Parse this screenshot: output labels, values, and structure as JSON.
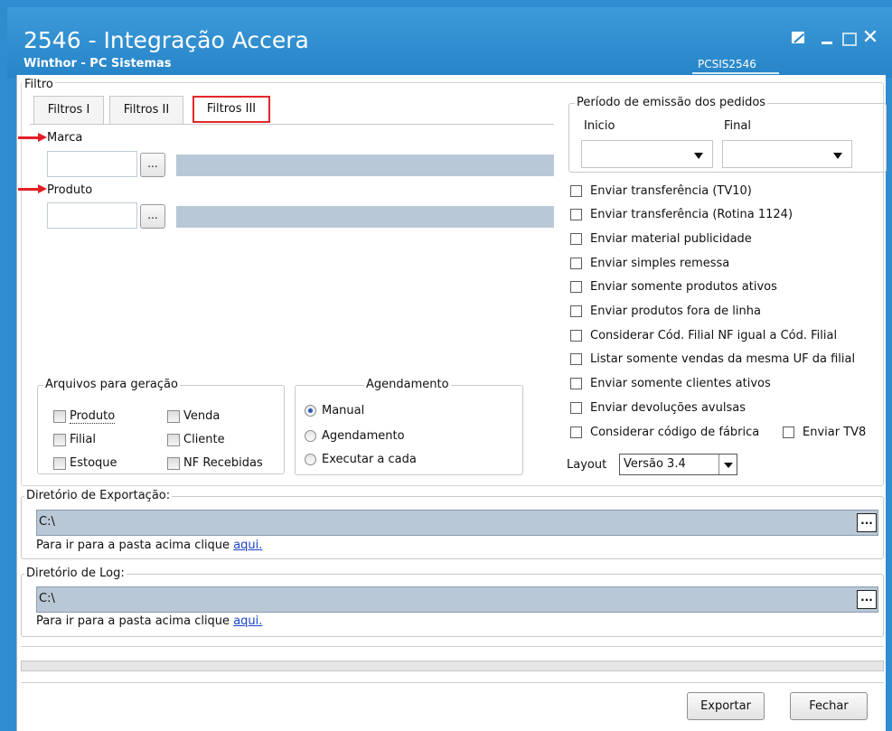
{
  "window": {
    "title": "2546 - Integração Accera",
    "subtitle": "Winthor - PC Sistemas",
    "code": "PCSIS2546",
    "close_glyph": "✕"
  },
  "filtro": {
    "legend": "Filtro",
    "tabs": [
      "Filtros I",
      "Filtros II",
      "Filtros III"
    ],
    "active_tab": "Filtros III",
    "marca_label": "Marca",
    "produto_label": "Produto",
    "ellipsis": "..."
  },
  "periodo": {
    "legend": "Período de emissão dos pedidos",
    "inicio_label": "Inicio",
    "final_label": "Final"
  },
  "options": [
    "Enviar transferência (TV10)",
    "Enviar transferência (Rotina 1124)",
    "Enviar material publicidade",
    "Enviar simples remessa",
    "Enviar somente produtos ativos",
    "Enviar produtos fora de linha",
    "Considerar Cód. Filial NF igual a Cód. Filial",
    "Listar somente vendas da mesma UF da filial",
    "Enviar somente clientes ativos",
    "Enviar devoluções avulsas",
    "Considerar código de fábrica"
  ],
  "enviar_tv8": "Enviar TV8",
  "layout": {
    "label": "Layout",
    "value": "Versão 3.4"
  },
  "arquivos": {
    "legend": "Arquivos para geração",
    "items": [
      "Produto",
      "Filial",
      "Estoque",
      "Venda",
      "Cliente",
      "NF Recebidas"
    ]
  },
  "agendamento": {
    "legend": "Agendamento",
    "options": [
      "Manual",
      "Agendamento",
      "Executar a cada"
    ],
    "selected": "Manual"
  },
  "export_dir": {
    "legend": "Diretório de Exportação:",
    "value": "C:\\",
    "hint": "Para ir para a pasta acima clique",
    "link": "aqui.",
    "btn": "..."
  },
  "log_dir": {
    "legend": "Diretório de Log:",
    "value": "C:\\",
    "hint": "Para ir para a pasta acima clique",
    "link": "aqui.",
    "btn": "..."
  },
  "buttons": {
    "exportar": "Exportar",
    "fechar": "Fechar"
  },
  "colors": {
    "title_bar": "#2684c8",
    "highlight": "#e2282a",
    "field_fill": "#b9c8d6",
    "link": "#1a44c9"
  }
}
